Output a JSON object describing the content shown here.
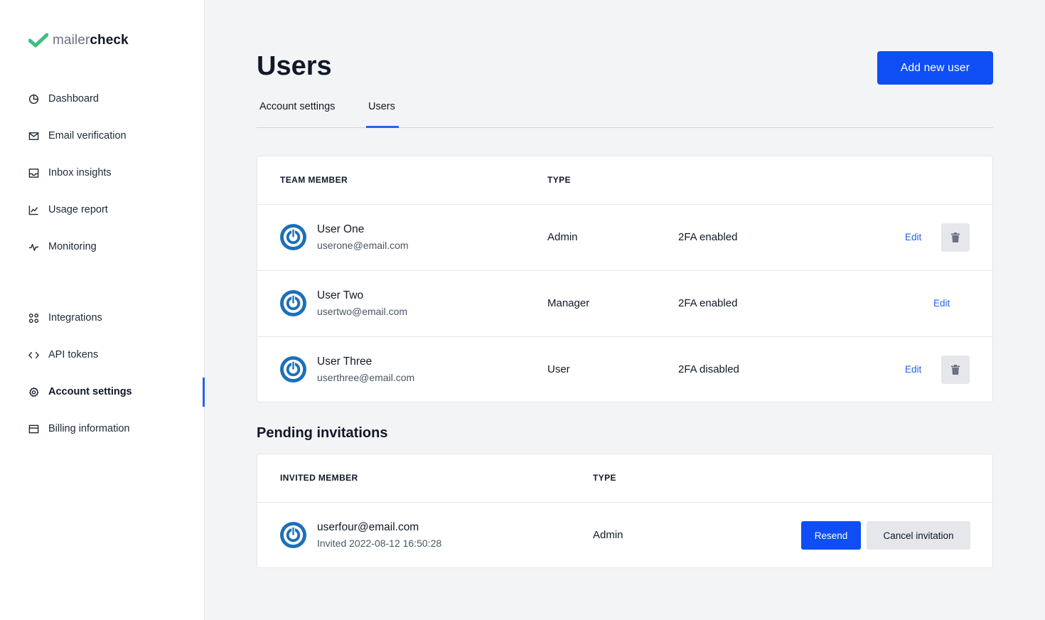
{
  "brand": {
    "light": "mailer",
    "dark": "check",
    "accent": "#3fbf7f"
  },
  "sidebar": {
    "items": [
      {
        "label": "Dashboard",
        "icon": "pie-chart-icon"
      },
      {
        "label": "Email verification",
        "icon": "mail-check-icon"
      },
      {
        "label": "Inbox insights",
        "icon": "inbox-icon"
      },
      {
        "label": "Usage report",
        "icon": "line-chart-icon"
      },
      {
        "label": "Monitoring",
        "icon": "activity-icon"
      },
      {
        "label": "Integrations",
        "icon": "command-icon"
      },
      {
        "label": "API tokens",
        "icon": "code-icon"
      },
      {
        "label": "Account settings",
        "icon": "gear-icon",
        "active": true
      },
      {
        "label": "Billing information",
        "icon": "credit-card-icon"
      }
    ]
  },
  "header": {
    "title": "Users",
    "add_button": "Add new user"
  },
  "tabs": [
    {
      "label": "Account settings"
    },
    {
      "label": "Users",
      "active": true
    }
  ],
  "users_table": {
    "headers": {
      "member": "TEAM MEMBER",
      "type": "TYPE"
    },
    "rows": [
      {
        "name": "User One",
        "email": "userone@email.com",
        "type": "Admin",
        "twofa": "2FA enabled",
        "edit": "Edit",
        "deletable": true
      },
      {
        "name": "User Two",
        "email": "usertwo@email.com",
        "type": "Manager",
        "twofa": "2FA enabled",
        "edit": "Edit",
        "deletable": false
      },
      {
        "name": "User Three",
        "email": "userthree@email.com",
        "type": "User",
        "twofa": "2FA disabled",
        "edit": "Edit",
        "deletable": true
      }
    ]
  },
  "pending": {
    "title": "Pending invitations",
    "headers": {
      "member": "INVITED MEMBER",
      "type": "TYPE"
    },
    "rows": [
      {
        "email": "userfour@email.com",
        "invited": "Invited 2022-08-12 16:50:28",
        "type": "Admin",
        "resend": "Resend",
        "cancel": "Cancel invitation"
      }
    ]
  },
  "colors": {
    "primary": "#0f4ef5",
    "link": "#2563eb",
    "avatar": "#1d6fb8"
  }
}
